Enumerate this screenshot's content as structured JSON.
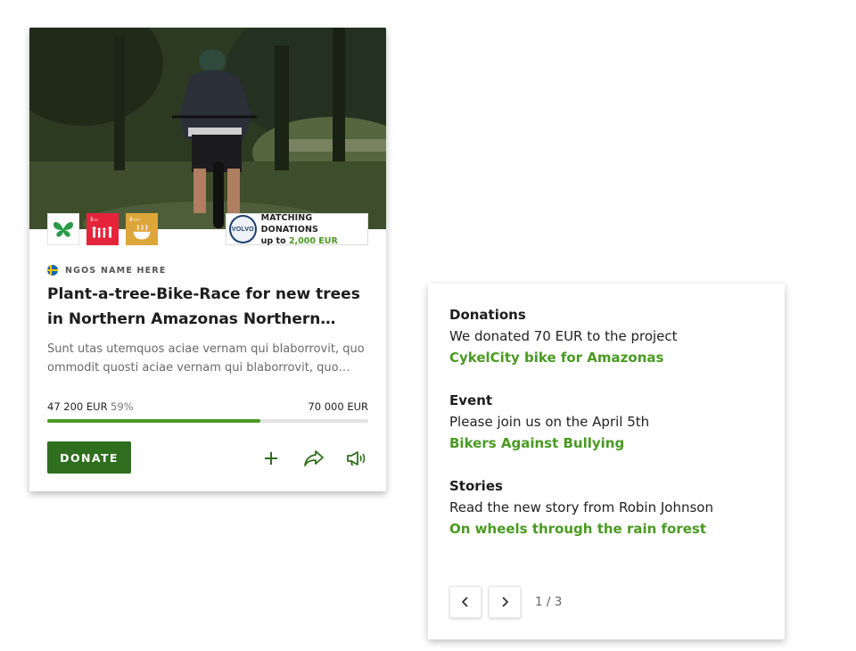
{
  "card": {
    "image_alt": "Cyclist on mountain bike in forest",
    "sdg_badges": [
      {
        "icon": "butterfly-icon",
        "color": "#2a9a4a"
      },
      {
        "icon": "sdg1-no-poverty-icon",
        "label": "1 NO POVERTY",
        "color": "#e5243b"
      },
      {
        "icon": "sdg2-zero-hunger-icon",
        "label": "2 ZERO HUNGER",
        "color": "#dda63a"
      }
    ],
    "matching": {
      "logo_text": "VOLVO",
      "title": "MATCHING DONATIONS",
      "sub_prefix": "up to",
      "sub_amount": "2,000 EUR"
    },
    "ngo_name": "NGOS NAME HERE",
    "title": "Plant-a-tree-Bike-Race for new trees in Northern Amazonas Northern continued text",
    "description": "Sunt utas utemquos aciae vernam qui blaborrovit, quo ommodit quosti aciae vernam qui blaborrovit, quo ommodit quosti",
    "raised": "47 200 EUR",
    "percent_label": "59%",
    "progress_fraction": 0.665,
    "goal": "70 000 EUR",
    "donate_label": "DONATE",
    "actions": [
      "plus-icon",
      "share-icon",
      "megaphone-icon"
    ]
  },
  "panel": {
    "entries": [
      {
        "heading": "Donations",
        "text": "We donated 70 EUR to the project",
        "link": "CykelCity bike for Amazonas"
      },
      {
        "heading": "Event",
        "text": "Please join us on the April 5th",
        "link": "Bikers Against Bullying"
      },
      {
        "heading": "Stories",
        "text": "Read the new story from Robin Johnson",
        "link": "On wheels through the rain forest"
      }
    ],
    "page_indicator": "1 / 3"
  },
  "colors": {
    "accent": "#4a9a22",
    "donate_bg": "#2f6e1e",
    "progress_track": "#e3e3e3"
  }
}
